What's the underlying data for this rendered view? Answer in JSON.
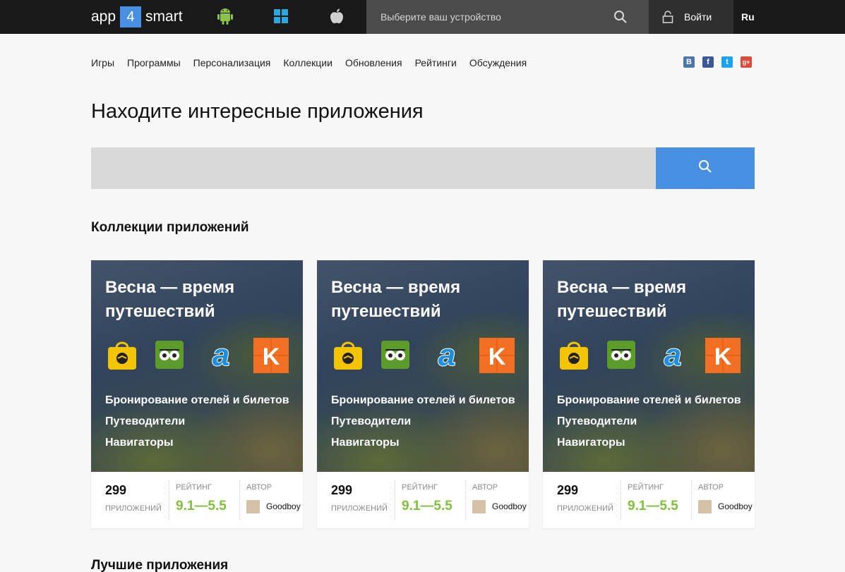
{
  "header": {
    "logo": {
      "left": "app",
      "num": "4",
      "right": "smart"
    },
    "device_placeholder": "Выберите ваш устройство",
    "login_label": "Войти",
    "lang": "Ru",
    "os_icons": [
      "android-icon",
      "windows-icon",
      "apple-icon"
    ]
  },
  "nav": {
    "items": [
      {
        "label": "Игры"
      },
      {
        "label": "Программы"
      },
      {
        "label": "Персонализация"
      },
      {
        "label": "Коллекции"
      },
      {
        "label": "Обновления"
      },
      {
        "label": "Рейтинги"
      },
      {
        "label": "Обсуждения"
      }
    ],
    "social": [
      {
        "icon": "vk-icon",
        "glyph": "B",
        "color": "#4a76a8"
      },
      {
        "icon": "facebook-icon",
        "glyph": "f",
        "color": "#3b5998"
      },
      {
        "icon": "twitter-icon",
        "glyph": "t",
        "color": "#1da1f2"
      },
      {
        "icon": "google-plus-icon",
        "glyph": "g+",
        "color": "#dd4b39"
      }
    ]
  },
  "hero": {
    "title": "Находите интересные приложения",
    "search_placeholder": ""
  },
  "collections": {
    "heading": "Коллекции приложений",
    "cards": [
      {
        "title": "Весна — время путешествий",
        "lines": [
          "Бронирование отелей и билетов",
          "Путеводители",
          "Навигаторы"
        ],
        "count": "299",
        "count_label": "ПРИЛОЖЕНИЙ",
        "rating_label": "РЕЙТИНГ",
        "rating": "9.1—5.5",
        "author_label": "АВТОР",
        "author": "Goodboy"
      },
      {
        "title": "Весна — время путешествий",
        "lines": [
          "Бронирование отелей и билетов",
          "Путеводители",
          "Навигаторы"
        ],
        "count": "299",
        "count_label": "ПРИЛОЖЕНИЙ",
        "rating_label": "РЕЙТИНГ",
        "rating": "9.1—5.5",
        "author_label": "АВТОР",
        "author": "Goodboy"
      },
      {
        "title": "Весна — время путешествий",
        "lines": [
          "Бронирование отелей и билетов",
          "Путеводители",
          "Навигаторы"
        ],
        "count": "299",
        "count_label": "ПРИЛОЖЕНИЙ",
        "rating_label": "РЕЙТИНГ",
        "rating": "9.1—5.5",
        "author_label": "АВТОР",
        "author": "Goodboy"
      }
    ]
  },
  "best": {
    "heading": "Лучшие приложения"
  },
  "colors": {
    "accent": "#4a90e2",
    "rating": "#7dc23a",
    "topbar": "#191919"
  }
}
